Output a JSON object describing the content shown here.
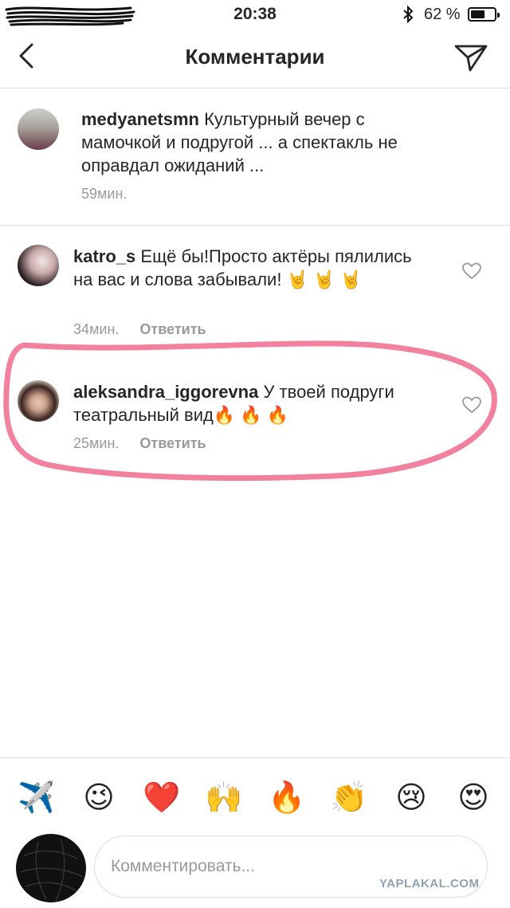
{
  "status_bar": {
    "time": "20:38",
    "battery_percent": "62 %",
    "battery_level": 0.62
  },
  "navbar": {
    "title": "Комментарии"
  },
  "caption": {
    "username": "medyanetsmn",
    "text": "Культурный вечер с мамочкой и подругой ... а спектакль не оправдал ожиданий ...",
    "time": "59мин."
  },
  "comments": [
    {
      "username": "katro_s",
      "text": "Ещё бы!Просто актёры пялились на вас и слова забывали! 🤘 🤘 🤘",
      "time": "34мин.",
      "reply_label": "Ответить"
    },
    {
      "username": "aleksandra_iggorevna",
      "text": "У твоей подруги театральный вид🔥 🔥 🔥",
      "time": "25мин.",
      "reply_label": "Ответить"
    }
  ],
  "emoji_bar": [
    "✈️",
    "😉",
    "❤️",
    "🙌",
    "🔥",
    "👏",
    "😢",
    "😍"
  ],
  "composer": {
    "placeholder": "Комментировать..."
  },
  "watermark": "YAPLAKAL.COM",
  "colors": {
    "highlight": "#f06a8e",
    "divider": "#dbdbdb",
    "secondary_text": "#999999"
  }
}
